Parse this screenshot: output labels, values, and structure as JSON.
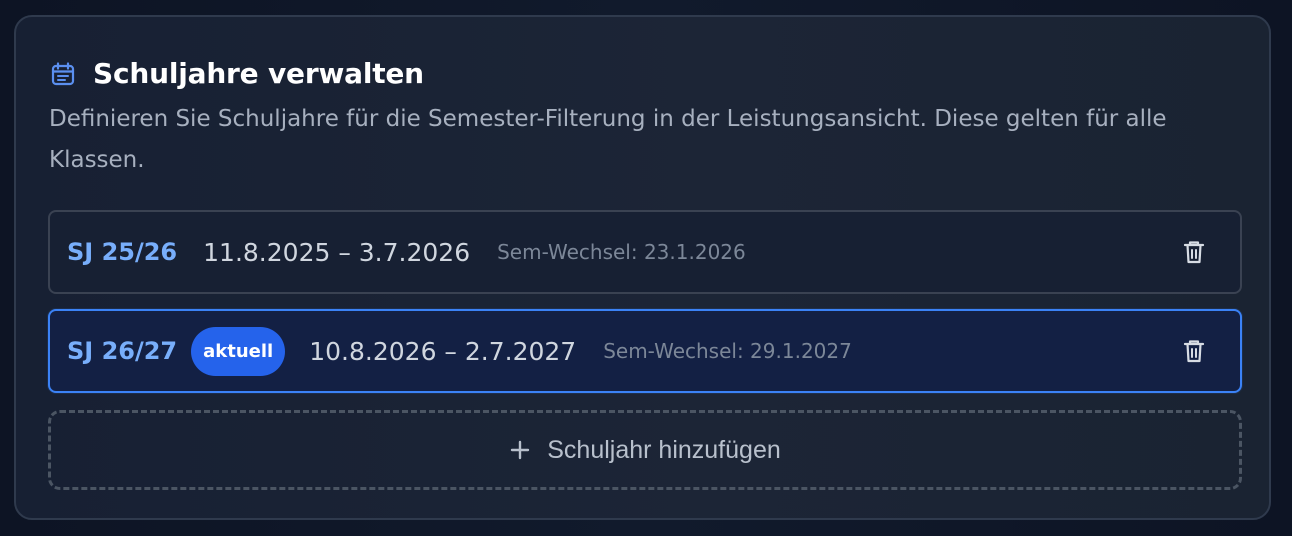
{
  "card": {
    "icon": "calendar-icon",
    "title": "Schuljahre verwalten",
    "description": "Definieren Sie Schuljahre für die Semester-Filterung in der Leistungsansicht. Diese gelten für alle Klassen."
  },
  "years": [
    {
      "label": "SJ 25/26",
      "date_range": "11.8.2025 – 3.7.2026",
      "semester_change": "Sem-Wechsel: 23.1.2026",
      "current": false,
      "delete_icon": "trash-icon"
    },
    {
      "label": "SJ 26/27",
      "badge": "aktuell",
      "date_range": "10.8.2026 – 2.7.2027",
      "semester_change": "Sem-Wechsel: 29.1.2027",
      "current": true,
      "delete_icon": "trash-icon"
    }
  ],
  "add_button": {
    "icon": "plus-icon",
    "label": "Schuljahr hinzufügen"
  },
  "colors": {
    "background": "#0f172a",
    "card_background": "#1c2536",
    "accent": "#3b82f6",
    "year_label": "#78aefb",
    "badge": "#2563eb"
  }
}
